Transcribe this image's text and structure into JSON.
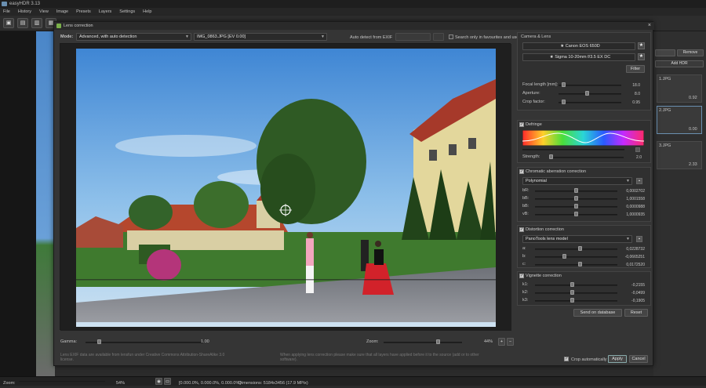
{
  "app": {
    "title": "easyHDR 3.13"
  },
  "menu": [
    "File",
    "History",
    "View",
    "Image",
    "Presets",
    "Layers",
    "Settings",
    "Help"
  ],
  "dialog": {
    "title": "Lens correction",
    "close": "×",
    "mode_label": "Mode:",
    "mode_value": "Advanced, with auto detection",
    "image_value": "IMG_0863.JPG [EV 0.00]",
    "autodetect_label": "Auto detect from EXIF",
    "search_label": "Search only in favourites and user",
    "gamma_label": "Gamma:",
    "gamma_value": "1.00",
    "gamma_pos": 0.1,
    "zoom_label": "Zoom:",
    "zoom_value": "44%",
    "zoom_pos": 0.7,
    "hint_left": "Lens EXIF data are available from lensfun under Creative Commons Attribution-ShareAlike 3.0 license.",
    "hint_right": "When applying lens correction please make sure that all layers have applied before it to the source (add or to other software).",
    "crop_label": "Crop automatically",
    "apply": "Apply",
    "cancel": "Cancel",
    "camera_lens": {
      "title": "Camera & Lens",
      "camera": "Canon EOS 650D",
      "lens": "Sigma 10-20mm f/3.5 EX DC",
      "filter": "Filter",
      "focal_label": "Focal length [mm]:",
      "focal_value": "18.0",
      "focal_pos": 0.05,
      "aperture_label": "Aperture:",
      "aperture_value": "8.0",
      "aperture_pos": 0.45,
      "crop_label": "Crop factor:",
      "crop_value": "0.95",
      "crop_pos": 0.05
    },
    "defringe": {
      "title": "Defringe",
      "strength_label": "Strength:",
      "strength_value": "2.0",
      "strength_pos": 0.0
    },
    "chromatic": {
      "title": "Chromatic aberration correction",
      "model": "Polynomial",
      "rows": [
        {
          "label": "bR:",
          "value": "0,0002702",
          "pos": 0.5
        },
        {
          "label": "bB:",
          "value": "1,0001558",
          "pos": 0.5
        },
        {
          "label": "bB:",
          "value": "0,0000988",
          "pos": 0.5
        },
        {
          "label": "vB:",
          "value": "1,0000935",
          "pos": 0.5
        }
      ]
    },
    "distortion": {
      "title": "Distortion correction",
      "model": "PanoTools lens model",
      "rows": [
        {
          "label": "a:",
          "value": "0,0228732",
          "pos": 0.55
        },
        {
          "label": "b:",
          "value": "-0,0665251",
          "pos": 0.35
        },
        {
          "label": "c:",
          "value": "0,0172520",
          "pos": 0.55
        }
      ]
    },
    "vignette": {
      "title": "Vignette correction",
      "rows": [
        {
          "label": "k1:",
          "value": "-0,2155",
          "pos": 0.45
        },
        {
          "label": "k2:",
          "value": "-0,0499",
          "pos": 0.45
        },
        {
          "label": "k3:",
          "value": "-0,1905",
          "pos": 0.45
        }
      ]
    },
    "lensfun_btn": "Send on database",
    "reset_btn": "Reset"
  },
  "right_panel": {
    "remove": "Remove",
    "add": "Add HDR",
    "thumbs": [
      {
        "name": "1.JPG",
        "ev": "0.92"
      },
      {
        "name": "2.JPG",
        "ev": "0.00"
      },
      {
        "name": "3.JPG",
        "ev": "2.33"
      }
    ]
  },
  "status": {
    "zoom_label": "Zoom:",
    "zoom_value": "54%",
    "coords": "[0.000.0%, 0.000.0%, 0.000.0%]",
    "dimensions": "Dimensions: 5184x3456 (17.9 MPix)"
  },
  "colors": {
    "accent": "#4a8fd0",
    "background": "#2b2b2b",
    "panel": "#353535"
  }
}
